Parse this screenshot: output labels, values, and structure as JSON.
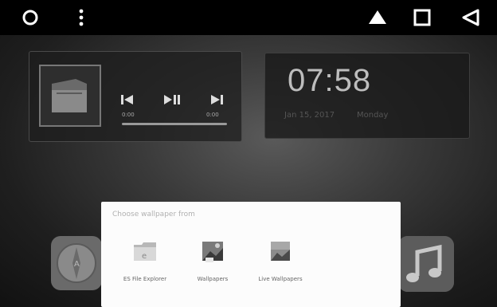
{
  "navbar": {
    "buttons": [
      "circle-icon",
      "overflow-dots-icon",
      "eject-icon",
      "recents-square-icon",
      "back-triangle-icon"
    ]
  },
  "music": {
    "time_start": "0:00",
    "time_end": "0:00"
  },
  "clock": {
    "time": "07:58",
    "date": "Jan 15, 2017",
    "location": "Monday"
  },
  "dialog": {
    "title": "Choose wallpaper from",
    "options": [
      {
        "label": "ES File Explorer"
      },
      {
        "label": "Wallpapers"
      },
      {
        "label": "Live Wallpapers"
      }
    ]
  },
  "colors": {
    "navbar": "#000000",
    "dialog_bg": "#fcfcfc",
    "clock_text": "#bdbdbd"
  }
}
